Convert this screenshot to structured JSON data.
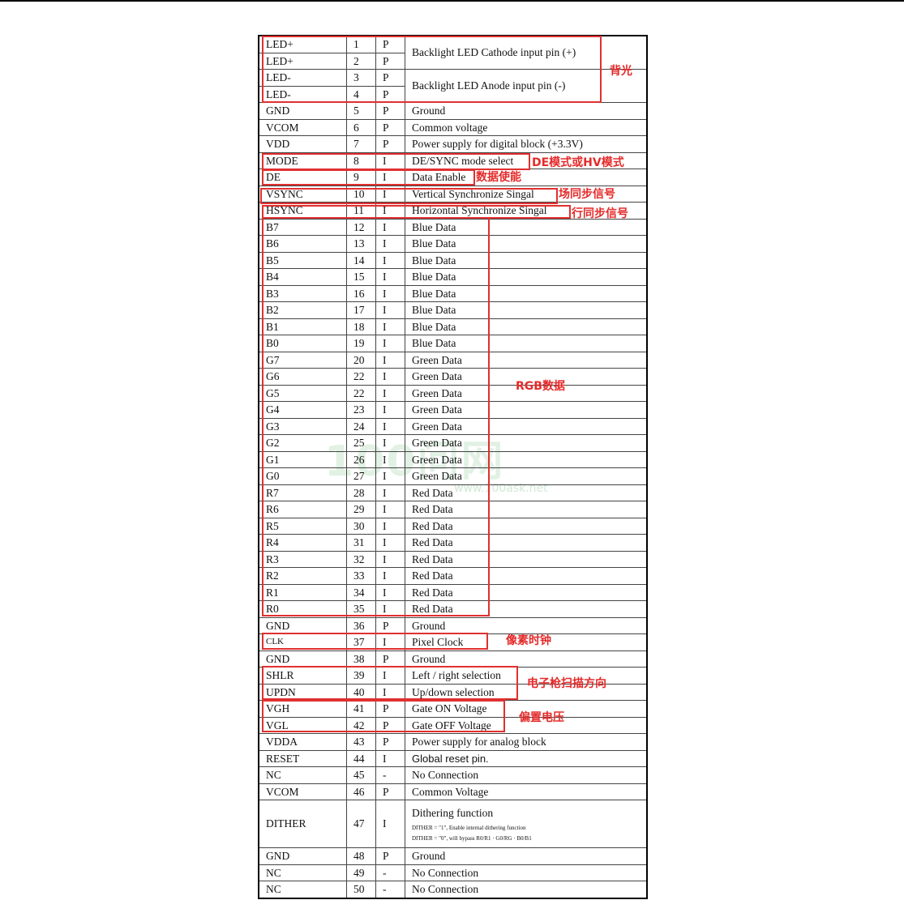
{
  "table": {
    "rows": [
      [
        "LED+",
        "1",
        "P"
      ],
      [
        "LED+",
        "2",
        "P"
      ],
      [
        "LED-",
        "3",
        "P"
      ],
      [
        "LED-",
        "4",
        "P"
      ],
      [
        "GND",
        "5",
        "P",
        "Ground"
      ],
      [
        "VCOM",
        "6",
        "P",
        "Common voltage"
      ],
      [
        "VDD",
        "7",
        "P",
        "Power supply for digital block    (+3.3V)"
      ],
      [
        "MODE",
        "8",
        "I",
        "DE/SYNC mode select"
      ],
      [
        "DE",
        "9",
        "I",
        "Data Enable"
      ],
      [
        "VSYNC",
        "10",
        "I",
        "Vertical Synchronize Singal"
      ],
      [
        "HSYNC",
        "11",
        "I",
        "Horizontal Synchronize Singal"
      ],
      [
        "B7",
        "12",
        "I",
        "Blue Data"
      ],
      [
        "B6",
        "13",
        "I",
        "Blue Data"
      ],
      [
        "B5",
        "14",
        "I",
        "Blue Data"
      ],
      [
        "B4",
        "15",
        "I",
        "Blue Data"
      ],
      [
        "B3",
        "16",
        "I",
        "Blue Data"
      ],
      [
        "B2",
        "17",
        "I",
        "Blue Data"
      ],
      [
        "B1",
        "18",
        "I",
        "Blue Data"
      ],
      [
        "B0",
        "19",
        "I",
        "Blue Data"
      ],
      [
        "G7",
        "20",
        "I",
        "Green Data"
      ],
      [
        "G6",
        "22",
        "I",
        "Green Data"
      ],
      [
        "G5",
        "22",
        "I",
        "Green Data"
      ],
      [
        "G4",
        "23",
        "I",
        "Green Data"
      ],
      [
        "G3",
        "24",
        "I",
        "Green Data"
      ],
      [
        "G2",
        "25",
        "I",
        "Green Data"
      ],
      [
        "G1",
        "26",
        "I",
        "Green Data"
      ],
      [
        "G0",
        "27",
        "I",
        "Green Data"
      ],
      [
        "R7",
        "28",
        "I",
        "Red Data"
      ],
      [
        "R6",
        "29",
        "I",
        "Red Data"
      ],
      [
        "R5",
        "30",
        "I",
        "Red Data"
      ],
      [
        "R4",
        "31",
        "I",
        "Red Data"
      ],
      [
        "R3",
        "32",
        "I",
        "Red Data"
      ],
      [
        "R2",
        "33",
        "I",
        "Red Data"
      ],
      [
        "R1",
        "34",
        "I",
        "Red Data"
      ],
      [
        "R0",
        "35",
        "I",
        "Red Data"
      ],
      [
        "GND",
        "36",
        "P",
        "Ground"
      ],
      [
        "CLK",
        "37",
        "I",
        "Pixel Clock"
      ],
      [
        "GND",
        "38",
        "P",
        "Ground"
      ],
      [
        "SHLR",
        "39",
        "I",
        "Left / right selection"
      ],
      [
        "UPDN",
        "40",
        "I",
        "Up/down selection"
      ],
      [
        "VGH",
        "41",
        "P",
        "Gate ON Voltage"
      ],
      [
        "VGL",
        "42",
        "P",
        "Gate OFF Voltage"
      ],
      [
        "VDDA",
        "43",
        "P",
        "Power supply for analog block"
      ],
      [
        "RESET",
        "44",
        "I",
        "Global reset pin."
      ],
      [
        "NC",
        "45",
        "-",
        "No Connection"
      ],
      [
        "VCOM",
        "46",
        "P",
        "Common Voltage"
      ],
      [
        "DITHER",
        "47",
        "I"
      ],
      [
        "GND",
        "48",
        "P",
        "Ground"
      ],
      [
        "NC",
        "49",
        "-",
        "No Connection"
      ],
      [
        "NC",
        "50",
        "-",
        "No Connection"
      ]
    ],
    "backlight_cathode": "Backlight LED Cathode input pin (+)",
    "backlight_anode": "Backlight LED Anode input pin (-)",
    "dither_title": "Dithering function",
    "dither_line1": "DITHER = \"1\", Enable internal dithering function",
    "dither_line2": "DITHER = \"0\", will bypass R0/R1 · G0/RG · B0/B1"
  },
  "annotations": {
    "backlight": "背光",
    "mode": "DE模式或HV模式",
    "data_enable": "数据使能",
    "vsync": "场同步信号",
    "hsync": "行同步信号",
    "rgb": "RGB数据",
    "pixel_clock": "像素时钟",
    "scan_direction": "电子枪扫描方向",
    "bias_voltage": "偏置电压"
  },
  "watermark": {
    "logo": "100问网",
    "url": "www.100ask.net"
  },
  "colors": {
    "annotation_red": "#e52a2a",
    "watermark_green": "#78be82"
  }
}
